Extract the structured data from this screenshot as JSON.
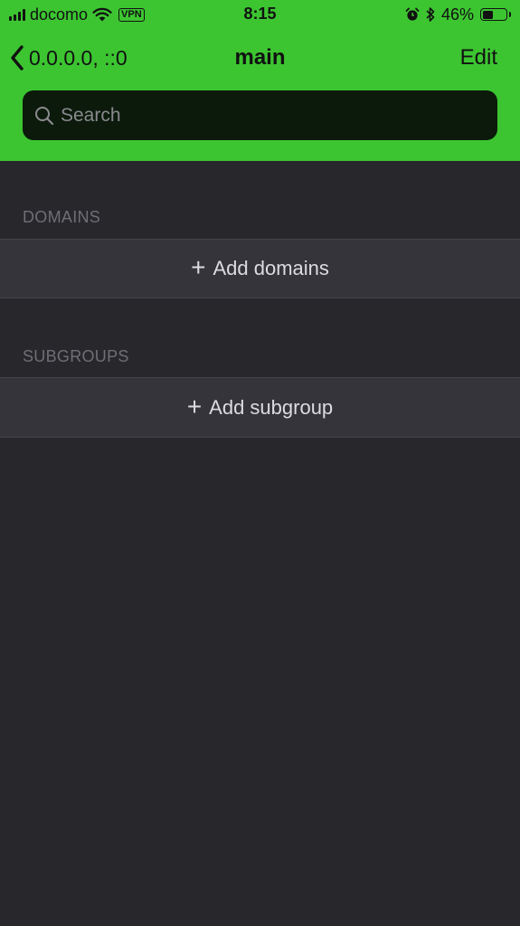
{
  "status_bar": {
    "carrier": "docomo",
    "vpn": "VPN",
    "time": "8:15",
    "battery": "46%",
    "battery_level": 0.46
  },
  "nav": {
    "back_label": "0.0.0.0, ::0",
    "title": "main",
    "edit_label": "Edit"
  },
  "search": {
    "placeholder": "Search",
    "value": ""
  },
  "sections": {
    "domains": {
      "header": "DOMAINS",
      "add_label": "Add domains"
    },
    "subgroups": {
      "header": "SUBGROUPS",
      "add_label": "Add subgroup"
    }
  },
  "colors": {
    "accent_green": "#3cc531",
    "background": "#27272c",
    "row_background": "#35343a",
    "search_background": "#0b1a0b"
  },
  "icons": [
    "signal-icon",
    "wifi-icon",
    "alarm-icon",
    "bluetooth-icon",
    "battery-icon",
    "chevron-left-icon",
    "search-icon",
    "plus-icon"
  ]
}
